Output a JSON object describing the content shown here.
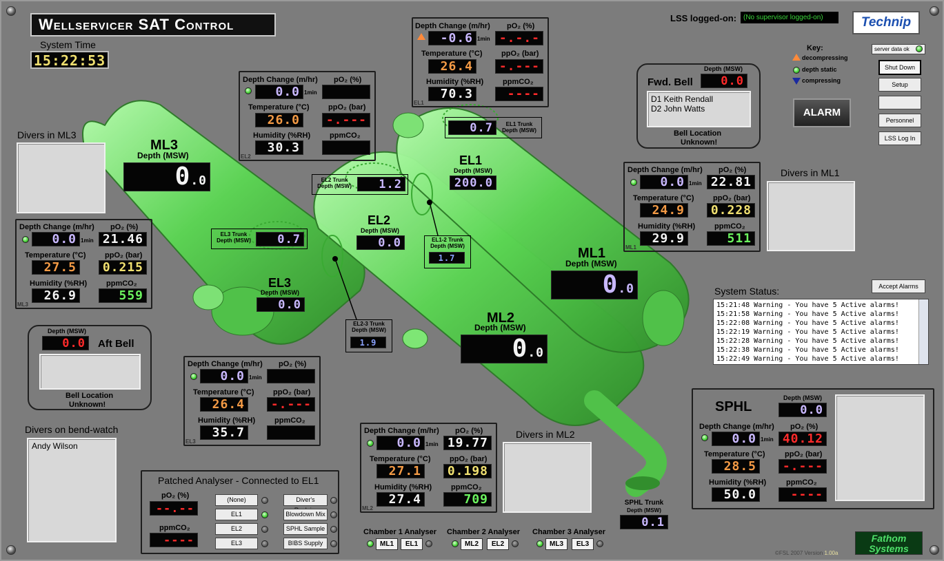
{
  "header": {
    "title": "Wellservicer SAT Control",
    "system_time_label": "System Time",
    "system_time": "15:22:53",
    "lss_label": "LSS logged-on:",
    "lss_value": "(No supervisor logged-on)",
    "brand": "Technip"
  },
  "key": {
    "title": "Key:",
    "decompressing": "decompressing",
    "static": "depth static",
    "compressing": "compressing"
  },
  "buttons": {
    "server_data": "server data ok",
    "shutdown": "Shut Down",
    "setup": "Setup",
    "blank": "",
    "personnel": "Personnel",
    "lss_login": "LSS Log In",
    "alarm": "ALARM",
    "accept_alarms": "Accept Alarms"
  },
  "labels": {
    "depth_change": "Depth Change (m/hr)",
    "po2": "pO₂ (%)",
    "temperature": "Temperature (°C)",
    "ppo2": "ppO₂ (bar)",
    "humidity": "Humidity (%RH)",
    "ppmco2": "ppmCO₂",
    "rate": "1min",
    "depth_msw": "Depth (MSW)"
  },
  "el1": {
    "name": "EL1",
    "tag": "EL1",
    "depth_change": "-0.6",
    "po2": "-.-.-",
    "temp": "26.4",
    "ppo2": "-.---",
    "humidity": "70.3",
    "ppmco2": "----",
    "depth": "200.0"
  },
  "el2": {
    "name": "EL2",
    "tag": "EL2",
    "depth_change": "0.0",
    "po2": "",
    "temp": "26.0",
    "ppo2": "-.---",
    "humidity": "30.3",
    "ppmco2": "",
    "depth": "0.0"
  },
  "el3": {
    "name": "EL3",
    "tag": "EL3",
    "depth_change": "0.0",
    "po2": "",
    "temp": "26.4",
    "ppo2": "-.---",
    "humidity": "35.7",
    "ppmco2": "",
    "depth": "0.0"
  },
  "ml1": {
    "name": "ML1",
    "tag": "ML1",
    "depth_change": "0.0",
    "po2": "22.81",
    "temp": "24.9",
    "ppo2": "0.228",
    "humidity": "29.9",
    "ppmco2": "511",
    "depth": "0",
    "depth_dec": ".0"
  },
  "ml2": {
    "name": "ML2",
    "tag": "ML2",
    "depth_change": "0.0",
    "po2": "19.77",
    "temp": "27.1",
    "ppo2": "0.198",
    "humidity": "27.4",
    "ppmco2": "709",
    "depth": "0",
    "depth_dec": ".0"
  },
  "ml3": {
    "name": "ML3",
    "tag": "ML3",
    "depth_change": "0.0",
    "po2": "21.46",
    "temp": "27.5",
    "ppo2": "0.215",
    "humidity": "26.9",
    "ppmco2": "559",
    "depth": "0",
    "depth_dec": ".0"
  },
  "trunks": {
    "el1": {
      "label": "EL1 Trunk",
      "sub": "Depth (MSW)",
      "value": "0.7"
    },
    "el2": {
      "label": "EL2 Trunk",
      "sub": "Depth (MSW)",
      "value": "1.2"
    },
    "el3": {
      "label": "EL3 Trunk",
      "sub": "Depth (MSW)",
      "value": "0.7"
    },
    "el12": {
      "label": "EL1-2 Trunk",
      "sub": "Depth (MSW)",
      "value": "1.7"
    },
    "el23": {
      "label": "EL2-3 Trunk",
      "sub": "Depth (MSW)",
      "value": "1.9"
    },
    "sphl": {
      "label": "SPHL Trunk",
      "sub": "Depth (MSW)",
      "value": "0.1"
    }
  },
  "fwd_bell": {
    "title": "Fwd. Bell",
    "depth": "0.0",
    "divers": [
      "D1 Keith Rendall",
      "D2 John Watts"
    ],
    "loc_label": "Bell Location",
    "loc_value": "Unknown!"
  },
  "aft_bell": {
    "title": "Aft Bell",
    "depth": "0.0",
    "loc_label": "Bell Location",
    "loc_value": "Unknown!"
  },
  "divers": {
    "ml3": "Divers in ML3",
    "ml1": "Divers in ML1",
    "ml2": "Divers in ML2",
    "bendwatch": "Divers on bend-watch",
    "bendwatch_names": [
      "Andy Wilson"
    ]
  },
  "sphl": {
    "title": "SPHL",
    "depth": "0.0",
    "depth_change": "0.0",
    "po2": "40.12",
    "temp": "28.5",
    "ppo2": "-.---",
    "humidity": "50.0",
    "ppmco2": "----"
  },
  "status": {
    "title": "System Status:",
    "lines": [
      "15:21:48 Warning - You have  5 Active alarms!",
      "15:21:58 Warning - You have  5 Active alarms!",
      "15:22:08 Warning - You have  5 Active alarms!",
      "15:22:19 Warning - You have  5 Active alarms!",
      "15:22:28 Warning - You have  5 Active alarms!",
      "15:22:38 Warning - You have  5 Active alarms!",
      "15:22:49 Warning - You have  5 Active alarms!"
    ]
  },
  "analyser": {
    "title": "Patched Analyser - Connected to EL1",
    "po2": "--.--",
    "ppmco2": "----",
    "opts_left": [
      "(None)",
      "EL1",
      "EL2",
      "EL3"
    ],
    "opts_right": [
      "Diver's Reclaim",
      "Blowdown Mix",
      "SPHL Sample",
      "BIBS Supply"
    ],
    "ch1": "Chamber 1 Analyser",
    "ch2": "Chamber 2 Analyser",
    "ch3": "Chamber 3 Analyser",
    "ch1a": "ML1",
    "ch1b": "EL1",
    "ch2a": "ML2",
    "ch2b": "EL2",
    "ch3a": "ML3",
    "ch3b": "EL3"
  },
  "footer": {
    "copyright": "©FSL 2007 Version",
    "version": "1.00a",
    "brand1": "Fathom",
    "brand2": "Systems"
  }
}
